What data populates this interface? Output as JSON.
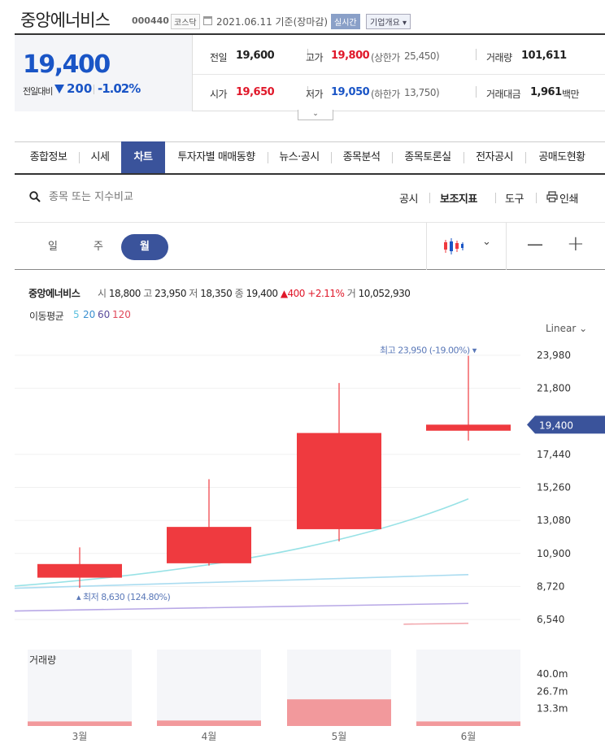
{
  "header": {
    "name": "중앙에너비스",
    "code": "000440",
    "market": "코스닥",
    "date": "2021.06.11 기준(장마감)",
    "live_badge": "실시간",
    "company_overview": "기업개요 ▾"
  },
  "summary": {
    "price": "19,400",
    "change_label": "전일대비",
    "change_value": "200",
    "change_pct": "-1.02%",
    "prev_close_label": "전일",
    "prev_close": "19,600",
    "high_label": "고가",
    "high": "19,800",
    "upper_limit_label": "(상한가",
    "upper_limit": "25,450)",
    "volume_label": "거래량",
    "volume": "101,611",
    "open_label": "시가",
    "open": "19,650",
    "low_label": "저가",
    "low": "19,050",
    "lower_limit_label": "(하한가",
    "lower_limit": "13,750)",
    "value_label": "거래대금",
    "value": "1,961",
    "value_unit": "백만",
    "expand_icon": "chevron-down-icon"
  },
  "tabs": [
    "종합정보",
    "시세",
    "차트",
    "투자자별 매매동향",
    "뉴스·공시",
    "종목분석",
    "종목토론실",
    "전자공시",
    "공매도현황"
  ],
  "active_tab": "차트",
  "toolbar": {
    "search_placeholder": "종목 또는 지수비교",
    "disclosure": "공시",
    "indicators": "보조지표",
    "tools": "도구",
    "print": "인쇄"
  },
  "periods": [
    "일",
    "주",
    "월"
  ],
  "active_period": "월",
  "chart_controls": {
    "zoom_out": "—",
    "zoom_in": "+",
    "chevron": "⌄"
  },
  "info": {
    "name": "중앙에너비스",
    "open_k": "시",
    "open": "18,800",
    "high_k": "고",
    "high": "23,950",
    "low_k": "저",
    "low": "18,350",
    "close_k": "종",
    "close": "19,400",
    "change": "▲400",
    "change_pct": "+2.11%",
    "vol_k": "거",
    "volume": "10,052,930"
  },
  "ma": {
    "label": "이동평균",
    "periods": [
      {
        "value": "5",
        "color": "#5bc0de"
      },
      {
        "value": "20",
        "color": "#3a8fd0"
      },
      {
        "value": "60",
        "color": "#5a4b9c"
      },
      {
        "value": "120",
        "color": "#e0485a"
      }
    ]
  },
  "scale_label": "Linear",
  "colors": {
    "up": "#ef3a3f",
    "down": "#1a55c6",
    "accent": "#3a539b",
    "vol": "#f2999c"
  },
  "chart_data": {
    "type": "candlestick",
    "categories": [
      "3월",
      "4월",
      "5월",
      "6월"
    ],
    "candles": [
      {
        "open": 9300,
        "high": 11300,
        "low": 8630,
        "close": 10200
      },
      {
        "open": 10250,
        "high": 15800,
        "low": 10100,
        "close": 12650
      },
      {
        "open": 12500,
        "high": 22150,
        "low": 11700,
        "close": 18850
      },
      {
        "open": 19000,
        "high": 23950,
        "low": 18350,
        "close": 19400
      }
    ],
    "moving_averages": [
      {
        "name": "5",
        "color": "#98e2e6",
        "points": [
          [
            0,
            8750
          ],
          [
            3,
            14500
          ]
        ]
      },
      {
        "name": "20",
        "color": "#aadcf0",
        "points": [
          [
            0,
            8600
          ],
          [
            3,
            9500
          ]
        ]
      },
      {
        "name": "60",
        "color": "#b8a8e6",
        "points": [
          [
            0,
            7100
          ],
          [
            3,
            7600
          ]
        ]
      },
      {
        "name": "120",
        "color": "#f2a8ae",
        "points": [
          [
            2.5,
            6230
          ],
          [
            3,
            6290
          ]
        ]
      }
    ],
    "y_ticks": [
      "23,980",
      "21,800",
      "17,440",
      "15,260",
      "13,080",
      "10,900",
      "8,720",
      "6,540"
    ],
    "y_tick_values": [
      23980,
      21800,
      17440,
      15260,
      13080,
      10900,
      8720,
      6540
    ],
    "current_price_label": "19,400",
    "current_price": 19400,
    "max_annotation": "최고 23,950 (-19.00%)",
    "min_annotation": "최저 8,630 (124.80%)",
    "volume": {
      "label": "거래량",
      "values_m": [
        3.5,
        4.2,
        20.5,
        3.5
      ],
      "y_ticks": [
        "40.0m",
        "26.7m",
        "13.3m"
      ],
      "y_tick_values": [
        40.0,
        26.7,
        13.3
      ],
      "ylim": [
        0,
        44
      ]
    }
  }
}
